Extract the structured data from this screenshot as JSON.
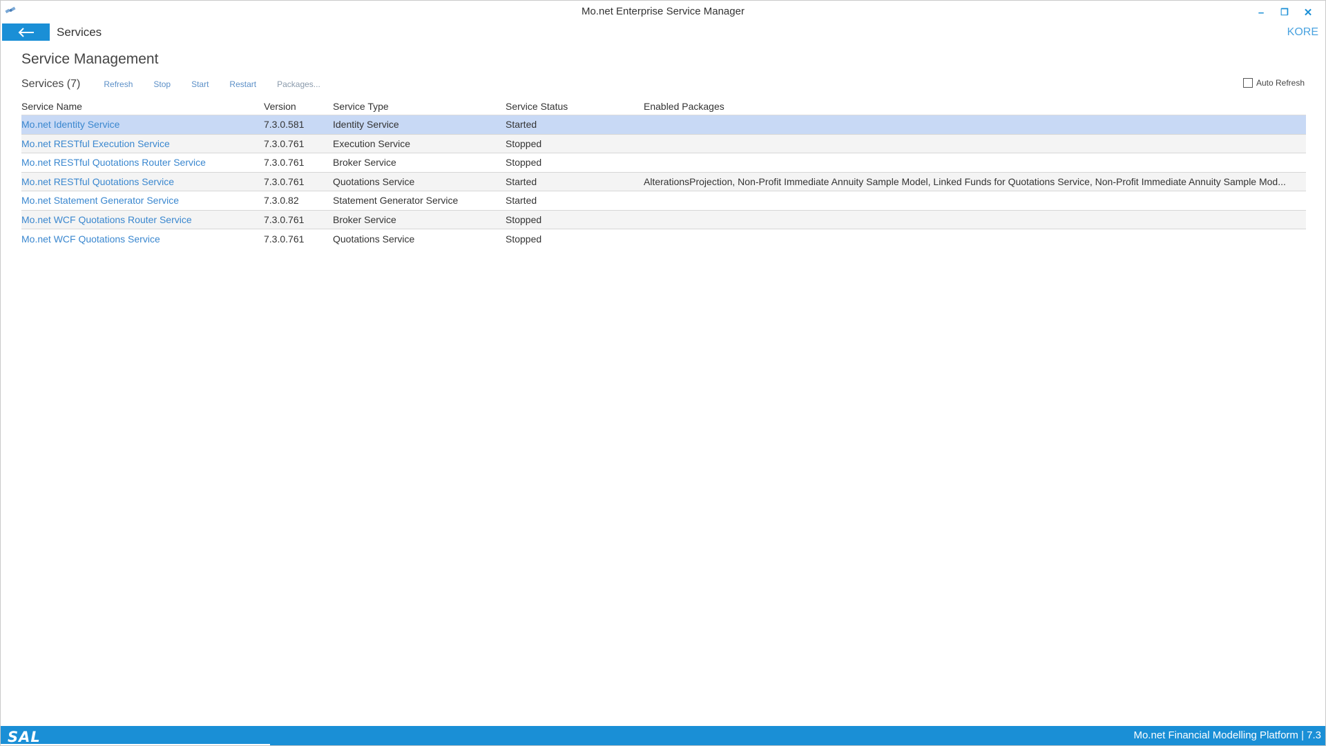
{
  "window": {
    "title": "Mo.net Enterprise Service Manager",
    "icon": "app-satellite-icon",
    "controls": {
      "minimize": "–",
      "restore": "❐",
      "close": "✕"
    }
  },
  "nav": {
    "back_icon": "arrow-left-icon",
    "title": "Services",
    "environment": "KORE"
  },
  "page": {
    "title": "Service Management"
  },
  "toolbar": {
    "services_count": "Services (7)",
    "refresh": "Refresh",
    "stop": "Stop",
    "start": "Start",
    "restart": "Restart",
    "packages": "Packages...",
    "auto_refresh": "Auto Refresh"
  },
  "table": {
    "headers": [
      "Service Name",
      "Version",
      "Service Type",
      "Service Status",
      "Enabled Packages"
    ],
    "rows": [
      {
        "name": "Mo.net Identity Service",
        "version": "7.3.0.581",
        "type": "Identity Service",
        "status": "Started",
        "packages": ""
      },
      {
        "name": "Mo.net RESTful Execution Service",
        "version": "7.3.0.761",
        "type": "Execution Service",
        "status": "Stopped",
        "packages": ""
      },
      {
        "name": "Mo.net RESTful Quotations Router Service",
        "version": "7.3.0.761",
        "type": "Broker Service",
        "status": "Stopped",
        "packages": ""
      },
      {
        "name": "Mo.net RESTful Quotations Service",
        "version": "7.3.0.761",
        "type": "Quotations Service",
        "status": "Started",
        "packages": "AlterationsProjection, Non-Profit Immediate Annuity Sample Model, Linked Funds for Quotations Service, Non-Profit Immediate Annuity Sample Mod..."
      },
      {
        "name": "Mo.net Statement Generator Service",
        "version": "7.3.0.82",
        "type": "Statement Generator Service",
        "status": "Started",
        "packages": ""
      },
      {
        "name": "Mo.net WCF Quotations Router Service",
        "version": "7.3.0.761",
        "type": "Broker Service",
        "status": "Stopped",
        "packages": ""
      },
      {
        "name": "Mo.net WCF Quotations Service",
        "version": "7.3.0.761",
        "type": "Quotations Service",
        "status": "Stopped",
        "packages": ""
      }
    ],
    "selected_row": 0
  },
  "footer": {
    "logo": "SAL",
    "text": "Mo.net Financial Modelling Platform | 7.3"
  },
  "colors": {
    "accent": "#1a8fd6",
    "link": "#3a87cf",
    "selected": "#c8d9f5"
  }
}
